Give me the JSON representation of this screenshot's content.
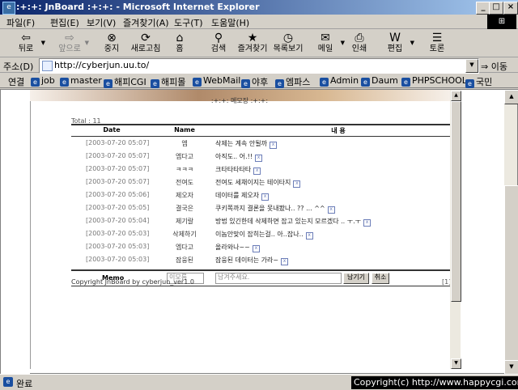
{
  "window": {
    "title": ":+:+: JnBoard :+:+: - Microsoft Internet Explorer",
    "minimize": "_",
    "maximize": "□",
    "close": "×"
  },
  "menu": [
    "파일(F)",
    "편집(E)",
    "보기(V)",
    "즐겨찾기(A)",
    "도구(T)",
    "도움말(H)"
  ],
  "toolbar": {
    "back": "뒤로",
    "forward": "앞으로",
    "stop": "중지",
    "refresh": "새로고침",
    "home": "홈",
    "search": "검색",
    "favorites": "즐겨찾기",
    "history": "목록보기",
    "mail": "메일",
    "print": "인쇄",
    "edit": "편집",
    "discuss": "토론"
  },
  "address": {
    "label": "주소(D)",
    "url": "http://cyberjun.uu.to/",
    "go": "이동"
  },
  "links": {
    "label": "연결",
    "items": [
      "job",
      "master",
      "해피CGI",
      "해피몰",
      "WebMail",
      "야후",
      "엠파스",
      "Admin",
      "Daum",
      "PHPSCHOOL",
      "국민"
    ]
  },
  "board": {
    "title": ":+:+: 메모장 :+:+:",
    "total": "Total : 11",
    "headers": {
      "date": "Date",
      "name": "Name",
      "content": "내 용"
    },
    "rows": [
      {
        "date": "[2003-07-20 05:07]",
        "name": "엠",
        "content": "삭제는 계속 안될까"
      },
      {
        "date": "[2003-07-20 05:07]",
        "name": "엠다고",
        "content": "아직도.. 어.!!"
      },
      {
        "date": "[2003-07-20 05:07]",
        "name": "ㅋㅋㅋ",
        "content": "크타타타타타"
      },
      {
        "date": "[2003-07-20 05:07]",
        "name": "전여도",
        "content": "전여도 세채이지는 테이타지"
      },
      {
        "date": "[2003-07-20 05:06]",
        "name": "제오자",
        "content": "데이터를 제오자"
      },
      {
        "date": "[2003-07-20 05:05]",
        "name": "결국은",
        "content": "쿠키쪽까지 결론을 못내봤나.. ?? ... ^^"
      },
      {
        "date": "[2003-07-20 05:04]",
        "name": "제기랄",
        "content": "방법 있긴한데 삭제하면 잡고 있는지 모르겠다 .. ㅜ.ㅜ"
      },
      {
        "date": "[2003-07-20 05:03]",
        "name": "삭제하기",
        "content": "이놈안맞이 잡히는걸.. 아..잡나.."
      },
      {
        "date": "[2003-07-20 05:03]",
        "name": "엠다고",
        "content": "올라와나~~"
      },
      {
        "date": "[2003-07-20 05:03]",
        "name": "잠웅된",
        "content": "잠웅된 데이터는 가라~"
      }
    ],
    "memo": {
      "label": "Memo",
      "name_placeholder": "이모름",
      "content_placeholder": "남겨주세요.",
      "submit": "남기기",
      "cancel": "취소"
    },
    "copyright": "Copyright JnBoard by cyberjun_ver1.0",
    "page": "[1]"
  },
  "status": {
    "text": "완료",
    "site_copyright": "Copyright(c) http://www.happycgi.com"
  }
}
